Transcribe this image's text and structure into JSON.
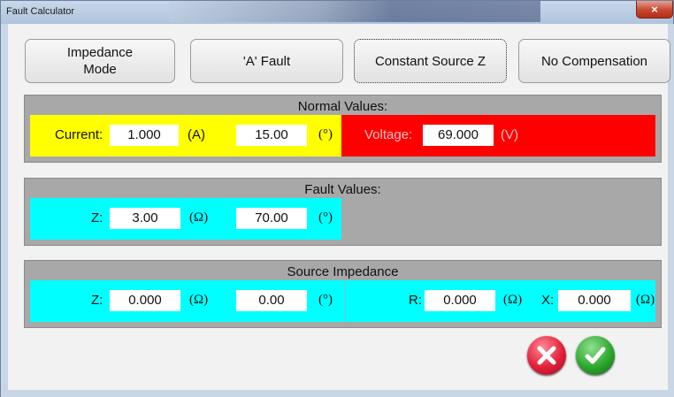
{
  "window": {
    "title": "Fault Calculator",
    "close_glyph": "×"
  },
  "mode_buttons": [
    {
      "label": "Impedance\nMode"
    },
    {
      "label": "'A' Fault"
    },
    {
      "label": "Constant Source Z"
    },
    {
      "label": "No Compensation"
    }
  ],
  "normal": {
    "title": "Normal Values:",
    "current_label": "Current:",
    "current_value": "1.000",
    "current_unit": "(A)",
    "current_angle": "15.00",
    "angle_unit": "(°)",
    "voltage_label": "Voltage:",
    "voltage_value": "69.000",
    "voltage_unit": "(V)",
    "colors": {
      "current_bg": "#ffff00",
      "voltage_bg": "#ff0000"
    }
  },
  "fault": {
    "title": "Fault Values:",
    "z_label": "Z:",
    "z_value": "3.00",
    "z_unit": "(Ω)",
    "angle_value": "70.00",
    "angle_unit": "(°)",
    "color": "#00ffff"
  },
  "source": {
    "title": "Source Impedance",
    "z_label": "Z:",
    "z_value": "0.000",
    "z_unit": "(Ω)",
    "angle_value": "0.00",
    "angle_unit": "(°)",
    "r_label": "R:",
    "r_value": "0.000",
    "r_unit": "(Ω)",
    "x_label": "X:",
    "x_value": "0.000",
    "x_unit": "(Ω)"
  },
  "actions": {
    "cancel_icon": "cancel-x-icon",
    "ok_icon": "check-icon"
  }
}
